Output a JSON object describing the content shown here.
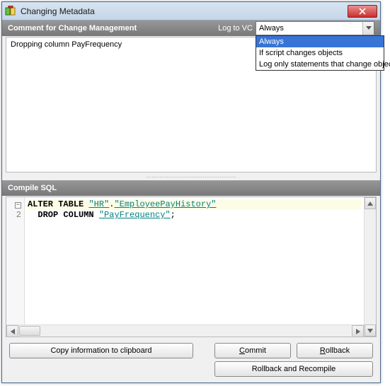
{
  "window": {
    "title": "Changing Metadata"
  },
  "sections": {
    "comment_header": "Comment for Change Management",
    "log_label": "Log to VC",
    "compile_header": "Compile SQL"
  },
  "dropdown": {
    "value": "Always",
    "options": [
      "Always",
      "If script changes objects",
      "Log only statements that change objects"
    ],
    "selected_index": 0
  },
  "comment_text": "Dropping column PayFrequency",
  "sql": {
    "line1": {
      "kw1": "ALTER",
      "kw2": "TABLE",
      "s1": "\"HR\"",
      "dot": ".",
      "s2": "\"EmployeePayHistory\""
    },
    "line2": {
      "kw1": "DROP",
      "kw2": "COLUMN",
      "s1": "\"PayFrequency\"",
      "end": ";"
    },
    "gutter2": "2"
  },
  "buttons": {
    "copy": "Copy information to clipboard",
    "commit_pre": "",
    "commit_mn": "C",
    "commit_post": "ommit",
    "rollback_pre": "",
    "rollback_mn": "R",
    "rollback_post": "ollback",
    "recompile": "Rollback and Recompile"
  }
}
